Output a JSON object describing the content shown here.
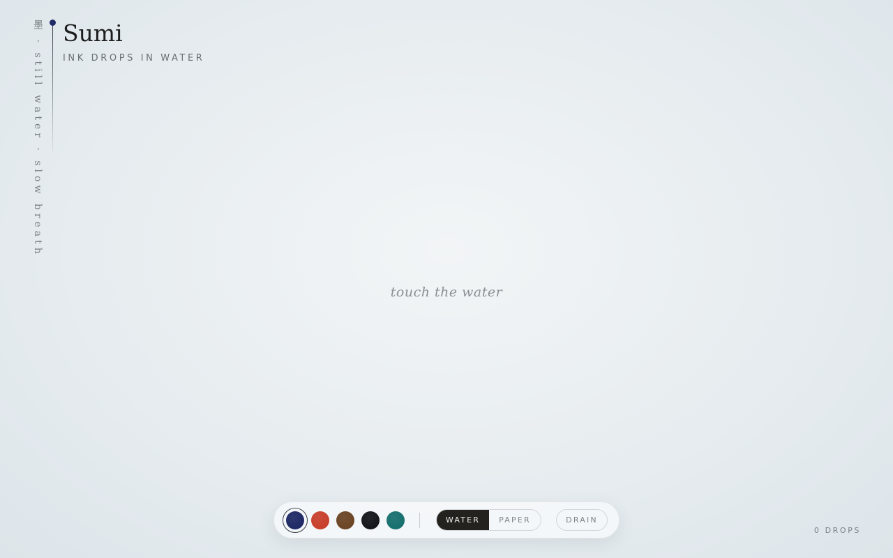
{
  "rail": {
    "text": "墨 · still water · slow breath"
  },
  "header": {
    "title": "Sumi",
    "subtitle": "INK DROPS IN WATER"
  },
  "canvas": {
    "prompt": "touch the water"
  },
  "toolbar": {
    "inks": [
      {
        "name": "indigo",
        "color": "#1f2a66",
        "selected": true
      },
      {
        "name": "vermilion",
        "color": "#c8402c",
        "selected": false
      },
      {
        "name": "sepia",
        "color": "#6b4525",
        "selected": false
      },
      {
        "name": "black",
        "color": "#15161b",
        "selected": false
      },
      {
        "name": "teal",
        "color": "#17706e",
        "selected": false
      }
    ],
    "modes": {
      "water": "WATER",
      "paper": "PAPER",
      "active": "water"
    },
    "drain_label": "DRAIN"
  },
  "status": {
    "drops": "0 DROPS"
  },
  "colors": {
    "accent": "#1f2a66",
    "active_mode_bg": "#24221f"
  }
}
